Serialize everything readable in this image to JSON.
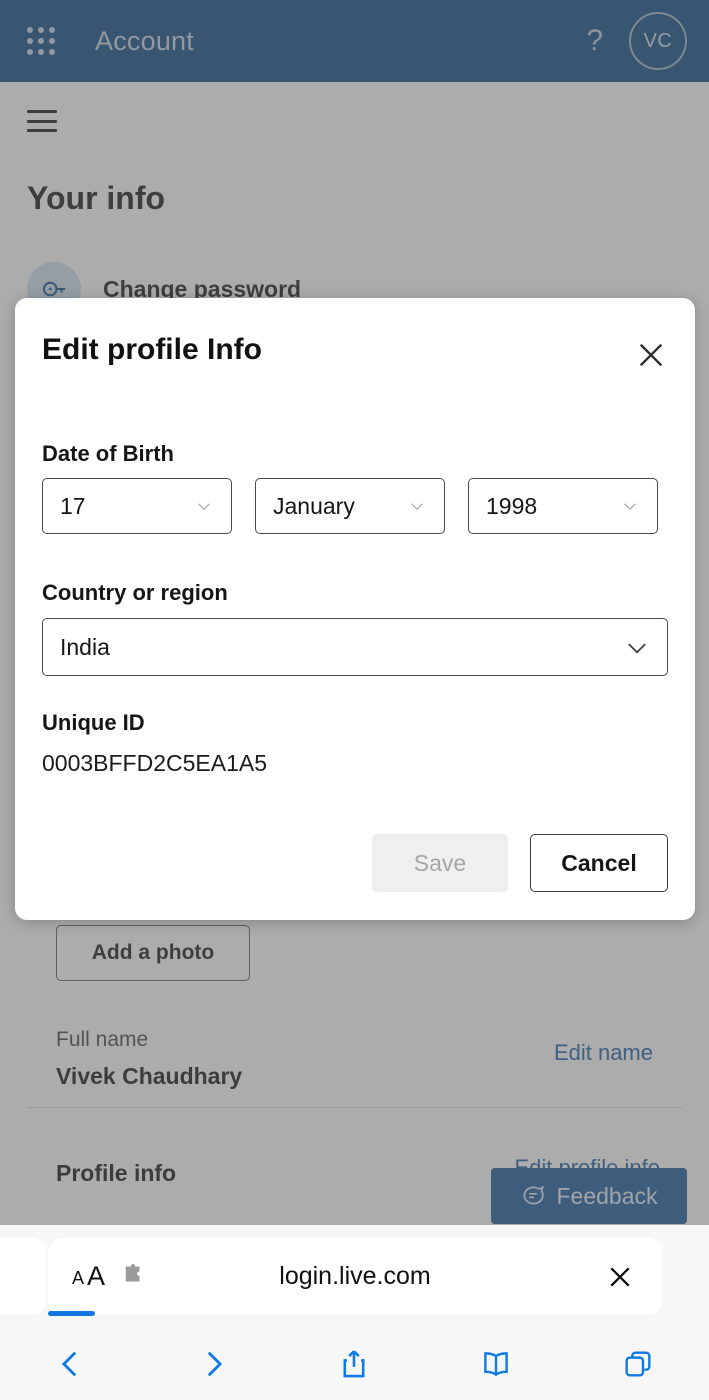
{
  "header": {
    "app_title": "Account",
    "waffle_icon": "app-launcher-grid-icon",
    "help_icon": "?",
    "avatar_initials": "VC",
    "background_color": "#0d4a85"
  },
  "page": {
    "menu_icon": "hamburger-menu-icon",
    "heading": "Your info",
    "change_password": {
      "label": "Change password",
      "icon": "key-circle-icon"
    },
    "add_photo_button": "Add a photo",
    "full_name": {
      "label": "Full name",
      "value": "Vivek Chaudhary",
      "action": "Edit name"
    },
    "profile_info": {
      "title": "Profile info",
      "action": "Edit profile info"
    },
    "feedback_button": {
      "label": "Feedback",
      "icon": "feedback-bubble-icon",
      "color": "#1a5a9e"
    }
  },
  "modal": {
    "title": "Edit profile Info",
    "close_icon": "close-x-icon",
    "dob": {
      "label": "Date of Birth",
      "day": "17",
      "month": "January",
      "year": "1998"
    },
    "country": {
      "label": "Country or region",
      "value": "India"
    },
    "unique_id": {
      "label": "Unique ID",
      "value": "0003BFFD2C5EA1A5"
    },
    "save_button": "Save",
    "save_disabled": true,
    "cancel_button": "Cancel"
  },
  "browser": {
    "text_size_label_small": "A",
    "text_size_label_large": "A",
    "extension_icon": "puzzle-piece-icon",
    "url": "login.live.com",
    "stop_icon": "close-x-icon",
    "accent_color": "#1277e2",
    "toolbar": {
      "back_icon": "chevron-left-icon",
      "forward_icon": "chevron-right-icon",
      "share_icon": "share-up-arrow-icon",
      "bookmarks_icon": "open-book-icon",
      "tabs_icon": "copy-pages-icon"
    }
  }
}
